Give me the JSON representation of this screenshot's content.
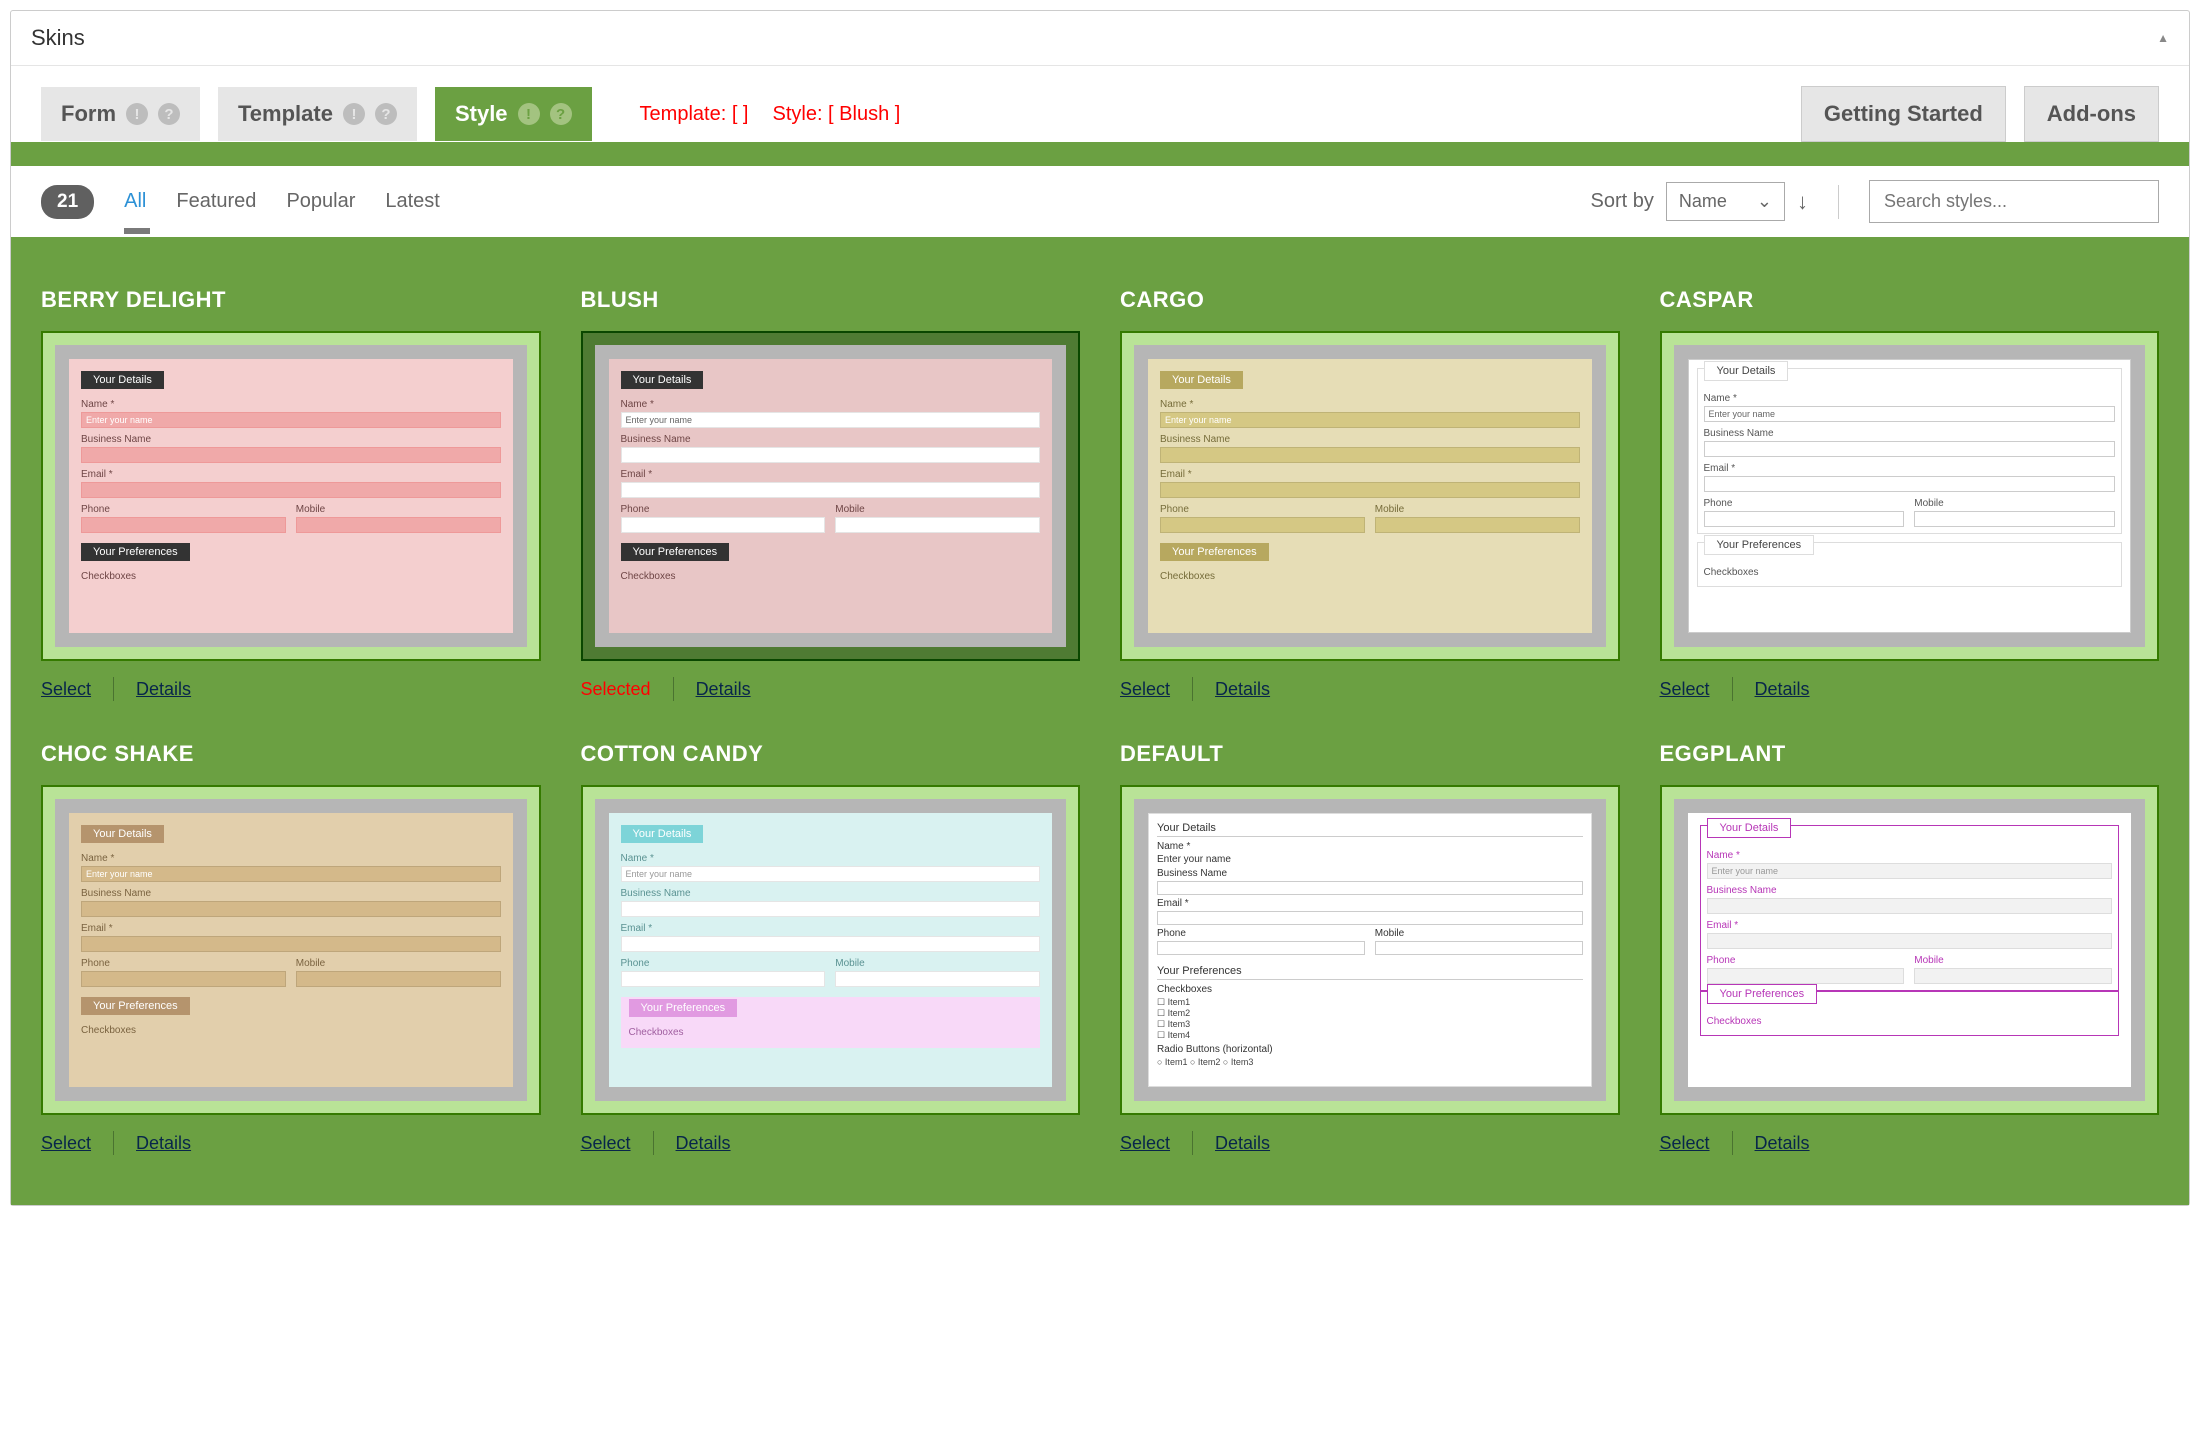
{
  "panel": {
    "title": "Skins"
  },
  "tabs": {
    "form_label": "Form",
    "template_label": "Template",
    "style_label": "Style"
  },
  "summary": {
    "template_label": "Template:  [   ]",
    "style_label": "Style: [ Blush ]"
  },
  "buttons": {
    "getting_started": "Getting Started",
    "addons": "Add-ons"
  },
  "filters": {
    "count": "21",
    "all": "All",
    "featured": "Featured",
    "popular": "Popular",
    "latest": "Latest"
  },
  "sort": {
    "label": "Sort by",
    "value": "Name"
  },
  "search": {
    "placeholder": "Search styles..."
  },
  "preview": {
    "your_details": "Your Details",
    "name": "Name *",
    "enter_name": "Enter your name",
    "business": "Business Name",
    "email": "Email *",
    "phone": "Phone",
    "mobile": "Mobile",
    "your_prefs": "Your Preferences",
    "checkboxes": "Checkboxes",
    "radio_h": "Radio Buttons (horizontal)",
    "item1": "Item1",
    "item2": "Item2",
    "item3": "Item3",
    "item4": "Item4",
    "radio_items": "○ Item1  ○ Item2  ○ Item3"
  },
  "actions": {
    "select": "Select",
    "details": "Details",
    "selected": "Selected"
  },
  "cards": [
    {
      "title": "BERRY DELIGHT",
      "theme": "th-berry",
      "selected": false
    },
    {
      "title": "BLUSH",
      "theme": "th-blush",
      "selected": true
    },
    {
      "title": "CARGO",
      "theme": "th-cargo",
      "selected": false
    },
    {
      "title": "CASPAR",
      "theme": "th-caspar",
      "selected": false
    },
    {
      "title": "CHOC SHAKE",
      "theme": "th-choc",
      "selected": false
    },
    {
      "title": "COTTON CANDY",
      "theme": "th-cotton",
      "selected": false
    },
    {
      "title": "DEFAULT",
      "theme": "th-default",
      "selected": false
    },
    {
      "title": "EGGPLANT",
      "theme": "th-eggplant",
      "selected": false
    }
  ]
}
